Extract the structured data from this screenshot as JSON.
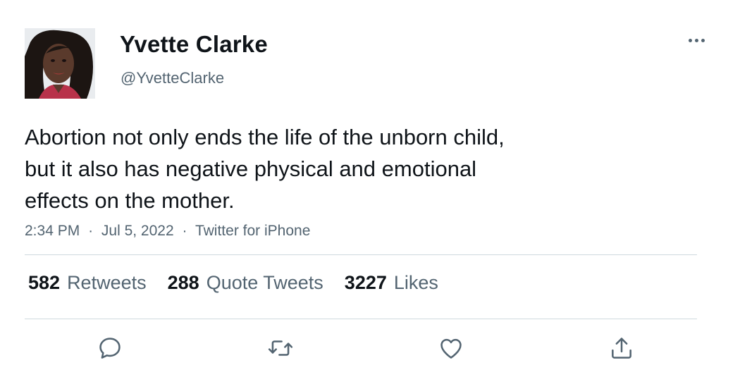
{
  "author": {
    "display_name": "Yvette Clarke",
    "handle": "@YvetteClarke"
  },
  "tweet": {
    "text_lines": [
      "Abortion not only ends the life of the unborn child,",
      "but it also has negative physical and emotional",
      "effects on the mother."
    ],
    "time": "2:34 PM",
    "date": "Jul 5, 2022",
    "source": "Twitter for iPhone",
    "separator": "·"
  },
  "stats": [
    {
      "count": "582",
      "label": "Retweets"
    },
    {
      "count": "288",
      "label": "Quote Tweets"
    },
    {
      "count": "3227",
      "label": "Likes"
    }
  ],
  "actions": [
    {
      "icon": "reply-icon"
    },
    {
      "icon": "retweet-icon"
    },
    {
      "icon": "like-icon"
    },
    {
      "icon": "share-icon"
    }
  ],
  "colors": {
    "text_primary": "#0f1419",
    "text_secondary": "#536471",
    "divider": "#cfd9de",
    "background": "#ffffff"
  }
}
